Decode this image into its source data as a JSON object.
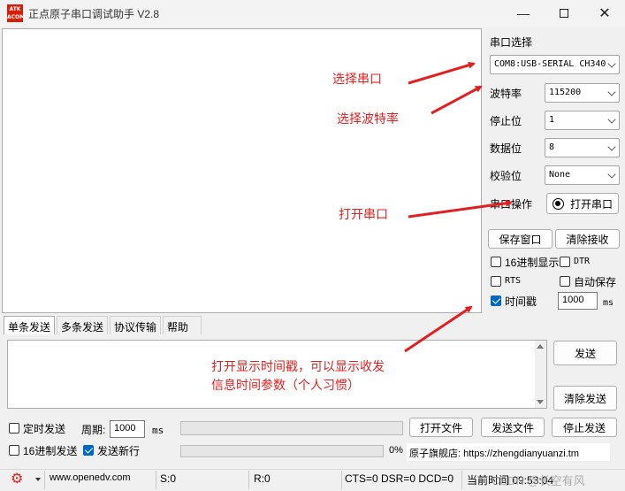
{
  "window": {
    "logo_text": "ATK ALIENTEK",
    "title": "正点原子串口调试助手 V2.8"
  },
  "serial": {
    "section_label": "串口选择",
    "port": "COM8:USB-SERIAL CH340",
    "baud_label": "波特率",
    "baud": "115200",
    "stop_label": "停止位",
    "stop": "1",
    "data_label": "数据位",
    "data": "8",
    "parity_label": "校验位",
    "parity": "None",
    "op_label": "串口操作",
    "open_button": "打开串口"
  },
  "receive": {
    "save_button": "保存窗口",
    "clear_button": "清除接收",
    "hex_display": {
      "label": "16进制显示",
      "checked": false
    },
    "dtr": {
      "label": "DTR",
      "checked": false
    },
    "rts": {
      "label": "RTS",
      "checked": false
    },
    "auto_save": {
      "label": "自动保存",
      "checked": false
    },
    "timestamp": {
      "label": "时间戳",
      "checked": true
    },
    "interval": "1000",
    "interval_unit": "ms"
  },
  "tabs": [
    "单条发送",
    "多条发送",
    "协议传输",
    "帮助"
  ],
  "send": {
    "send_button": "发送",
    "clear_send_button": "清除发送",
    "timed_send": {
      "label": "定时发送",
      "checked": false
    },
    "period_label": "周期:",
    "period": "1000",
    "period_unit": "ms",
    "open_file_button": "打开文件",
    "send_file_button": "发送文件",
    "stop_send_button": "停止发送",
    "hex_send": {
      "label": "16进制发送",
      "checked": false
    },
    "newline": {
      "label": "发送新行",
      "checked": true
    },
    "progress_text": "0%",
    "progress": 0,
    "store_text": "原子旗舰店: https://zhengdianyuanzi.tm"
  },
  "status": {
    "url": "www.openedv.com",
    "sent": "S:0",
    "received": "R:0",
    "lines": "CTS=0 DSR=0 DCD=0",
    "time": "当前时间 09:53:04",
    "watermark": "CSDN @长空有风"
  },
  "annotations": {
    "select_port": "选择串口",
    "select_baud": "选择波特率",
    "open_port": "打开串口",
    "timestamp_note_1": "打开显示时间戳，可以显示收发",
    "timestamp_note_2": "信息时间参数（个人习惯）"
  },
  "colors": {
    "annotation": "#e02020",
    "checkbox_checked": "#0067c0",
    "logo": "#d81e06"
  }
}
